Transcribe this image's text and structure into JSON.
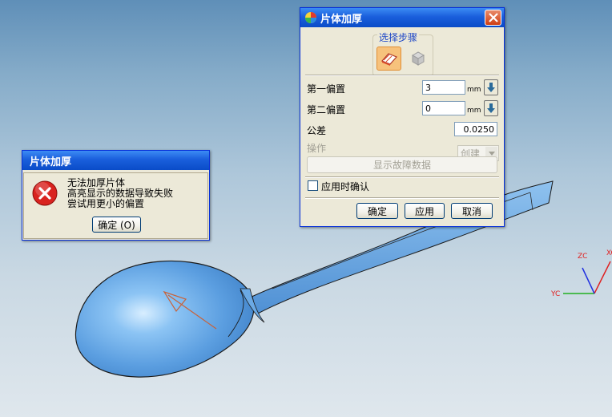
{
  "thicken_dialog": {
    "title": "片体加厚",
    "steps_label": "选择步骤",
    "first_offset": {
      "label": "第一偏置",
      "value": "3",
      "unit": "mm"
    },
    "second_offset": {
      "label": "第二偏置",
      "value": "0",
      "unit": "mm"
    },
    "tolerance": {
      "label": "公差",
      "value": "0.0250"
    },
    "operation": {
      "label": "操作",
      "value": "创建"
    },
    "show_failure_button": "显示故障数据",
    "confirm_on_apply": "应用时确认",
    "ok_button": "确定",
    "apply_button": "应用",
    "cancel_button": "取消"
  },
  "error_dialog": {
    "title": "片体加厚",
    "messages": [
      "无法加厚片体",
      "高亮显示的数据导致失败",
      "尝试用更小的偏置"
    ],
    "ok_button": "确定 (O)"
  },
  "axes": {
    "zc": "ZC",
    "xc": "XC",
    "yc": "YC"
  },
  "colors": {
    "title_bar": "#0a4cc8",
    "dialog_bg": "#ece9d8",
    "spoon": "#5b9ee0",
    "axis_x": "#e02020",
    "axis_y": "#20b020",
    "axis_z": "#2030e0"
  },
  "icons": {
    "app": "nx-app-icon",
    "close": "close-icon",
    "error": "error-icon",
    "step_face": "select-face-step-icon",
    "step_body": "select-body-step-icon",
    "arrow": "arrow-down-icon"
  }
}
